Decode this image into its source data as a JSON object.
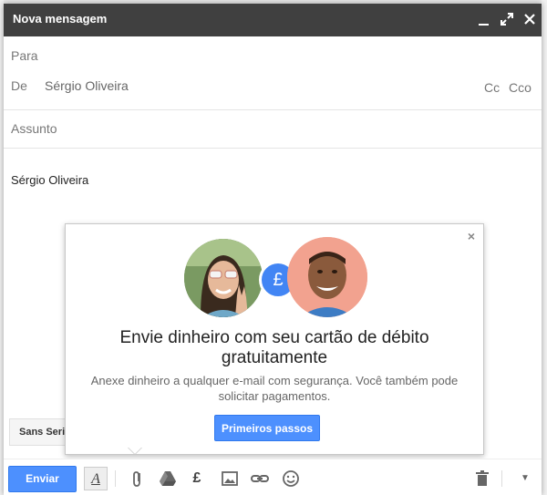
{
  "window": {
    "title": "Nova mensagem"
  },
  "fields": {
    "to_label": "Para",
    "from_label": "De",
    "from_value": "Sérgio Oliveira",
    "cc_label": "Cc",
    "bcc_label": "Cco",
    "subject_label": "Assunto"
  },
  "body": {
    "signature": "Sérgio Oliveira"
  },
  "formatting": {
    "font_chip": "Sans Serif"
  },
  "promo": {
    "badge_symbol": "£",
    "title": "Envie dinheiro com seu cartão de débito gratuitamente",
    "text": "Anexe dinheiro a qualquer e-mail com segurança. Você também pode solicitar pagamentos.",
    "button_label": "Primeiros passos"
  },
  "toolbar": {
    "send_label": "Enviar",
    "format_label": "A",
    "money_symbol": "£"
  },
  "colors": {
    "titlebar": "#404040",
    "primary_button": "#4d90fe",
    "badge": "#4285f4"
  },
  "icons": [
    "minimize-icon",
    "expand-icon",
    "close-icon",
    "attach-icon",
    "drive-icon",
    "money-icon",
    "photo-icon",
    "link-icon",
    "emoji-icon",
    "trash-icon",
    "more-options-icon"
  ]
}
